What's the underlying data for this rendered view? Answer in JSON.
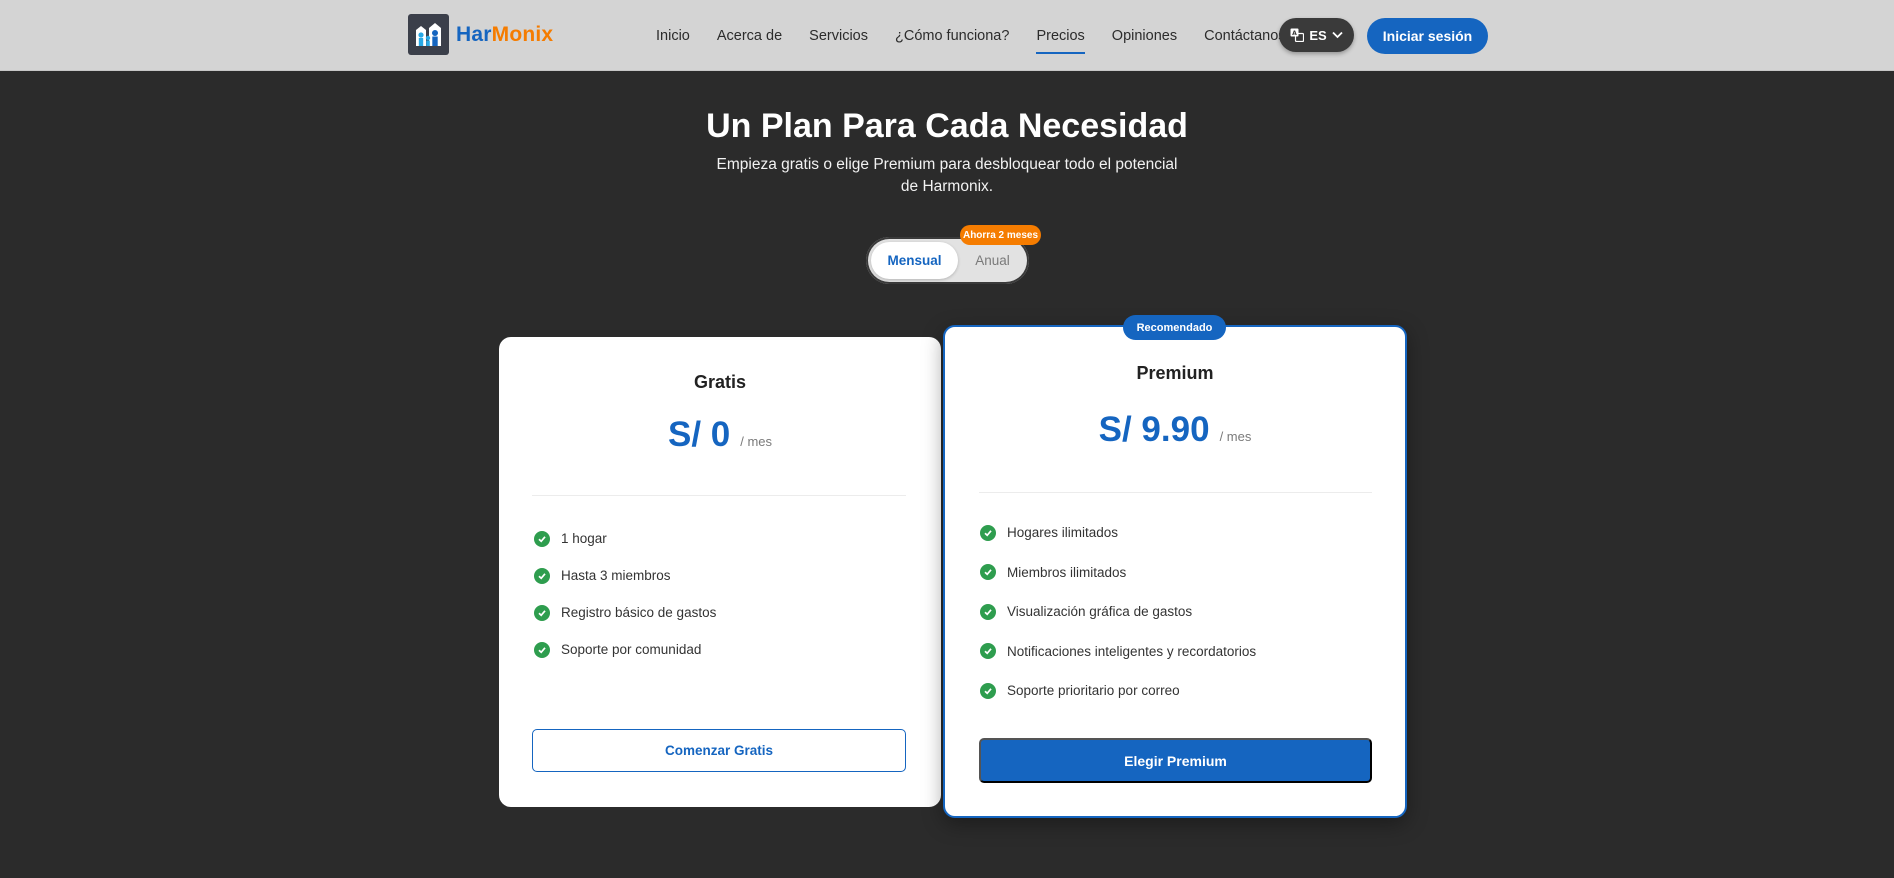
{
  "brand": {
    "name_part1": "Har",
    "name_part2": "Monix",
    "colors": {
      "primary": "#1565c0",
      "accent": "#f57c00"
    }
  },
  "nav": {
    "items": [
      {
        "label": "Inicio"
      },
      {
        "label": "Acerca de"
      },
      {
        "label": "Servicios"
      },
      {
        "label": "¿Cómo funciona?"
      },
      {
        "label": "Precios",
        "active": true
      },
      {
        "label": "Opiniones"
      },
      {
        "label": "Contáctanos"
      }
    ]
  },
  "header": {
    "language": "ES",
    "login_label": "Iniciar sesión"
  },
  "hero": {
    "title": "Un Plan Para Cada Necesidad",
    "subtitle": "Empieza gratis o elige Premium para desbloquear todo el potencial de Harmonix."
  },
  "billing": {
    "monthly": "Mensual",
    "annual": "Anual",
    "save_badge": "Ahorra 2 meses",
    "selected": "Mensual"
  },
  "plans": [
    {
      "name": "Gratis",
      "price": "S/ 0",
      "period": "/ mes",
      "features": [
        "1 hogar",
        "Hasta 3 miembros",
        "Registro básico de gastos",
        "Soporte por comunidad"
      ],
      "cta": "Comenzar Gratis"
    },
    {
      "name": "Premium",
      "badge": "Recomendado",
      "price": "S/ 9.90",
      "period": "/ mes",
      "features": [
        "Hogares ilimitados",
        "Miembros ilimitados",
        "Visualización gráfica de gastos",
        "Notificaciones inteligentes y recordatorios",
        "Soporte prioritario por correo"
      ],
      "cta": "Elegir Premium"
    }
  ]
}
